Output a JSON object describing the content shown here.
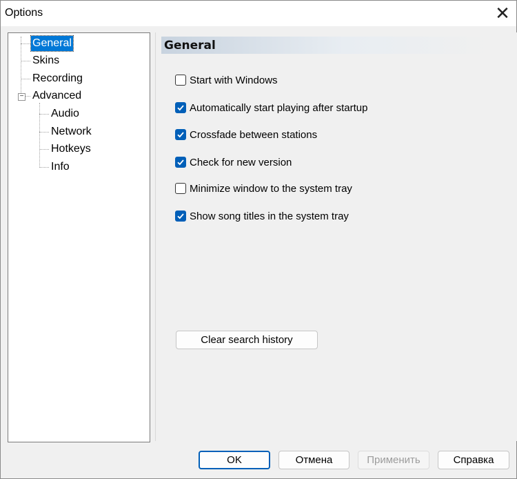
{
  "window": {
    "title": "Options"
  },
  "tree": {
    "items": [
      {
        "label": "General",
        "selected": true
      },
      {
        "label": "Skins"
      },
      {
        "label": "Recording"
      },
      {
        "label": "Advanced",
        "expanded": true
      },
      {
        "label": "Audio"
      },
      {
        "label": "Network"
      },
      {
        "label": "Hotkeys"
      },
      {
        "label": "Info"
      }
    ]
  },
  "panel": {
    "header": "General",
    "options": [
      {
        "label": "Start with Windows",
        "checked": false
      },
      {
        "label": "Automatically start playing after startup",
        "checked": true
      },
      {
        "label": "Crossfade between stations",
        "checked": true
      },
      {
        "label": "Check for new version",
        "checked": true
      },
      {
        "label": "Minimize window to the system tray",
        "checked": false
      },
      {
        "label": "Show song titles in the system tray",
        "checked": true
      }
    ],
    "clear_history_label": "Clear search history"
  },
  "buttons": {
    "ok": "OK",
    "cancel": "Отмена",
    "apply": "Применить",
    "help": "Справка"
  },
  "colors": {
    "accent": "#005fb8",
    "selection": "#0078d7"
  }
}
